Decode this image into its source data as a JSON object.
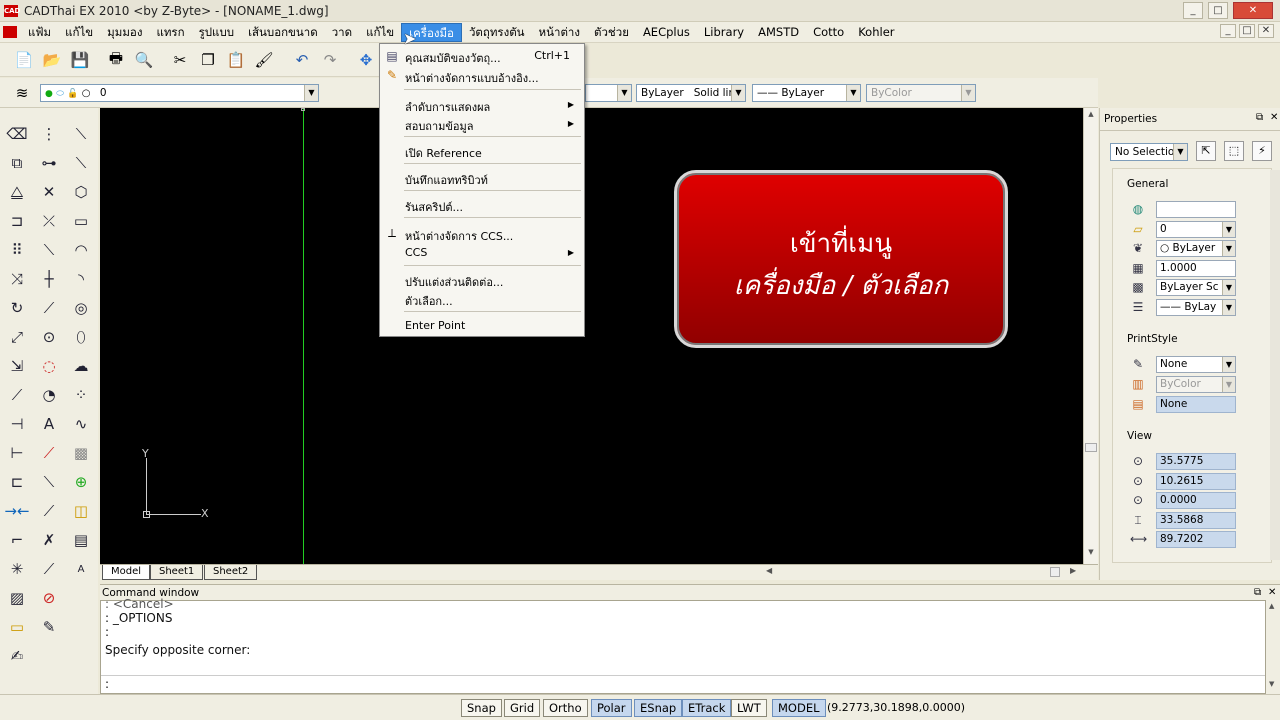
{
  "app": {
    "title": "CADThai EX 2010 <by Z-Byte> - [NONAME_1.dwg]",
    "icon_label": "CAD",
    "window_buttons": [
      "_",
      "□",
      "✕"
    ],
    "doc_buttons": [
      "_",
      "□",
      "✕"
    ]
  },
  "menubar": {
    "items": [
      "แฟ้ม",
      "แก้ไข",
      "มุมมอง",
      "แทรก",
      "รูปแบบ",
      "เส้นบอกขนาด",
      "วาด",
      "แก้ไข",
      "เครื่องมือ",
      "วัตถุทรงตัน",
      "หน้าต่าง",
      "ตัวช่วย",
      "AECplus",
      "Library",
      "AMSTD",
      "Cotto",
      "Kohler"
    ],
    "active_index": 8
  },
  "layer_bar": {
    "layer_value": "0",
    "linetype_color": "ByLayer",
    "linetype_value": "Solid line",
    "lineweight_value": "—— ByLayer",
    "plotstyle_value": "ByColor"
  },
  "tools_menu": {
    "items": [
      {
        "label": "คุณสมบัติของวัตถุ...",
        "shortcut": "Ctrl+1",
        "icon": "properties-icon"
      },
      {
        "label": "หน้าต่างจัดการแบบอ้างอิง...",
        "shortcut": "",
        "icon": "xref-manager-icon"
      },
      {
        "label": "ลำดับการแสดงผล",
        "submenu": true
      },
      {
        "label": "สอบถามข้อมูล",
        "submenu": true
      },
      {
        "label": "เปิด Reference"
      },
      {
        "label": "บันทึกแอททริบิวท์"
      },
      {
        "label": "รันสคริปต์..."
      },
      {
        "label": "หน้าต่างจัดการ CCS...",
        "icon": "ccs-icon"
      },
      {
        "label": "CCS",
        "submenu": true
      },
      {
        "label": "ปรับแต่งส่วนติดต่อ..."
      },
      {
        "label": "ตัวเลือก..."
      },
      {
        "label": "Enter Point"
      }
    ]
  },
  "callout": {
    "line1": "เข้าที่เมนู",
    "line2": "เครื่องมือ / ตัวเลือก"
  },
  "canvas": {
    "axis_x": "X",
    "axis_y": "Y"
  },
  "layout_tabs": [
    "Model",
    "Sheet1",
    "Sheet2"
  ],
  "properties": {
    "title": "Properties",
    "selection": "No Selection",
    "general_label": "General",
    "general_values": [
      "",
      "0",
      "○ ByLayer",
      "1.0000",
      "ByLayer    Sc",
      "—— ByLay"
    ],
    "printstyle_label": "PrintStyle",
    "printstyle_values": [
      "None",
      "ByColor",
      "None"
    ],
    "view_label": "View",
    "view_values": [
      "35.5775",
      "10.2615",
      "0.0000",
      "33.5868",
      "89.7202"
    ]
  },
  "command": {
    "title": "Command window",
    "lines": [
      ": <Cancel>",
      ": _OPTIONS",
      ":",
      "Specify opposite corner:"
    ],
    "prompt": ":"
  },
  "status": {
    "buttons": [
      {
        "label": "Snap",
        "on": false
      },
      {
        "label": "Grid",
        "on": false
      },
      {
        "label": "Ortho",
        "on": false
      },
      {
        "label": "Polar",
        "on": true
      },
      {
        "label": "ESnap",
        "on": true
      },
      {
        "label": "ETrack",
        "on": true
      },
      {
        "label": "LWT",
        "on": false
      },
      {
        "label": "MODEL",
        "on": true
      }
    ],
    "coords": "(9.2773,30.1898,0.0000)"
  },
  "colors": {
    "accent": "#3a8ee6",
    "callout_red": "#c80000",
    "canvas": "#000000",
    "green_line": "#22cc22"
  }
}
